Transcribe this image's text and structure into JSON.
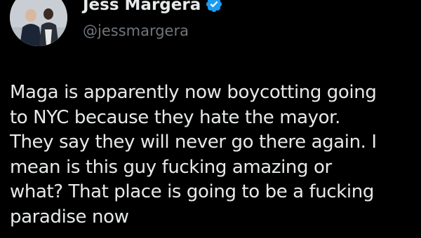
{
  "author": {
    "display_name": "Jess Margera",
    "handle": "@jessmargera",
    "verified": true,
    "avatar_icon": "profile-photo"
  },
  "tweet": {
    "text": "Maga is apparently now boycotting going\nto NYC because they hate the mayor.\nThey say they will never go there again. I\nmean is this guy fucking amazing or\nwhat? That place is going to be a fucking\nparadise now"
  },
  "colors": {
    "background": "#000000",
    "primary_text": "#e7e9ea",
    "secondary_text": "#71767b",
    "verified_badge": "#1d9bf0"
  }
}
